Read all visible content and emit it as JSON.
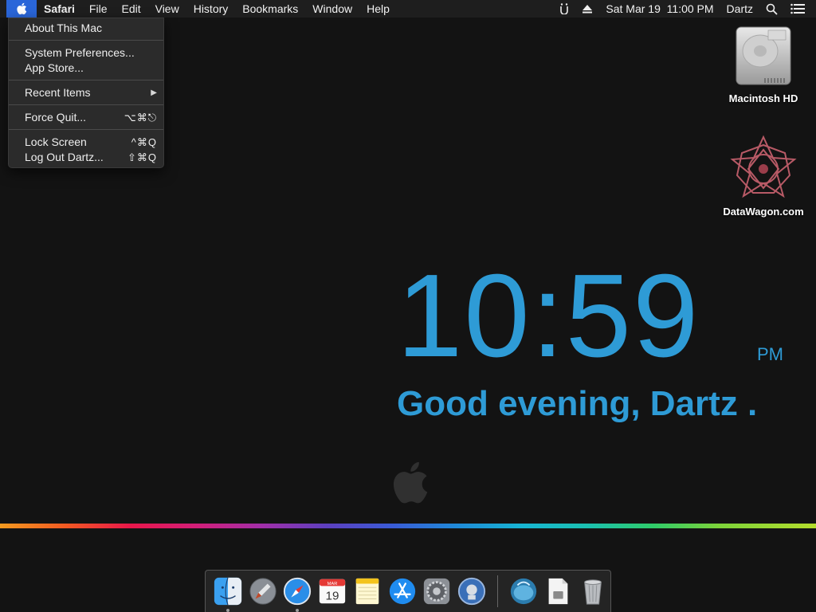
{
  "menubar": {
    "app_name": "Safari",
    "menus": [
      "File",
      "Edit",
      "View",
      "History",
      "Bookmarks",
      "Window",
      "Help"
    ],
    "status": {
      "datetime": "Sat Mar 19  11:00 PM",
      "user": "Dartz"
    },
    "icons": [
      "apple-icon",
      "accessibility-icon",
      "eject-icon",
      "spotlight-search-icon",
      "notification-center-icon"
    ]
  },
  "apple_menu": {
    "items": [
      {
        "label": "About This Mac",
        "shortcut": ""
      },
      {
        "label": "System Preferences...",
        "shortcut": ""
      },
      {
        "label": "App Store...",
        "shortcut": ""
      },
      {
        "label": "Recent Items",
        "shortcut": "▶"
      },
      {
        "label": "Force Quit...",
        "shortcut": "⌥⌘⎋"
      },
      {
        "label": "Lock Screen",
        "shortcut": "^⌘Q"
      },
      {
        "label": "Log Out Dartz...",
        "shortcut": "⇧⌘Q"
      }
    ]
  },
  "desktop": {
    "icons": [
      {
        "label": "Macintosh HD",
        "icon": "hard-drive-icon"
      },
      {
        "label": "DataWagon.com",
        "icon": "datawagon-logo-icon"
      }
    ]
  },
  "clock_widget": {
    "time": "10:59",
    "ampm": "PM",
    "greeting": "Good evening, Dartz ."
  },
  "dock": {
    "calendar_month": "MAR",
    "calendar_day": "19",
    "apps": [
      "finder-icon",
      "launchpad-icon",
      "safari-icon",
      "calendar-icon",
      "notes-icon",
      "app-store-icon",
      "system-preferences-icon",
      "disk-utility-icon",
      "downloads-folder-icon",
      "document-icon",
      "trash-icon"
    ]
  },
  "colors": {
    "accent_blue": "#2e9bd6",
    "menu_highlight": "#2a66d9",
    "desktop_bg": "#131313"
  }
}
